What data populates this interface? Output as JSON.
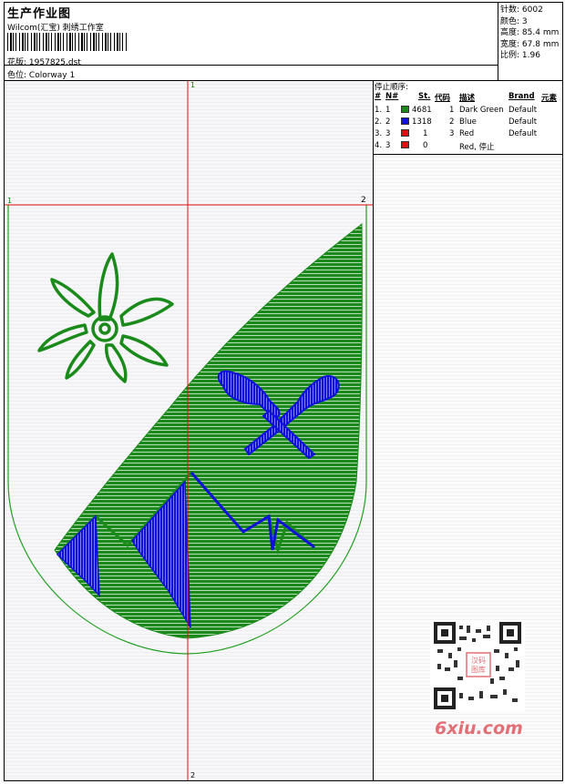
{
  "header": {
    "title": "生产作业图",
    "company": "Wilcom(汇宝) 刺绣工作室",
    "design_label": "花版:",
    "design_value": "1957825.dst",
    "colorway_label": "色位:",
    "colorway_value": "Colorway 1"
  },
  "stats": [
    {
      "label": "针数:",
      "value": "6002"
    },
    {
      "label": "颜色:",
      "value": "3"
    },
    {
      "label": "高度:",
      "value": "85.4 mm"
    },
    {
      "label": "宽度:",
      "value": "67.8 mm"
    },
    {
      "label": "比例:",
      "value": "1.96"
    }
  ],
  "stop_sequence": {
    "title": "停止顺序:",
    "columns": [
      "#",
      "N#",
      "St.",
      "代码",
      "描述",
      "Brand",
      "元素"
    ],
    "rows": [
      {
        "idx": "1.",
        "n": "1",
        "color": "#1a8a1a",
        "stitches": "4681",
        "code": "1",
        "desc": "Dark Green",
        "brand": "Default"
      },
      {
        "idx": "2.",
        "n": "2",
        "color": "#1010dd",
        "stitches": "1318",
        "code": "2",
        "desc": "Blue",
        "brand": "Default"
      },
      {
        "idx": "3.",
        "n": "3",
        "color": "#dd1010",
        "stitches": "1",
        "code": "3",
        "desc": "Red",
        "brand": "Default"
      },
      {
        "idx": "4.",
        "n": "3",
        "color": "#dd1010",
        "stitches": "0",
        "code": "",
        "desc": "Red, 停止",
        "brand": ""
      }
    ]
  },
  "guides": {
    "v_top": "1",
    "v_bottom": "2",
    "h_left": "1",
    "h_right": "2"
  },
  "colors": {
    "green": "#1a8a1a",
    "blue": "#1010dd",
    "red": "#dd1010",
    "outline": "#22a022"
  },
  "watermark": {
    "text": "6xiu.com",
    "stamp": "汉码 图库"
  }
}
